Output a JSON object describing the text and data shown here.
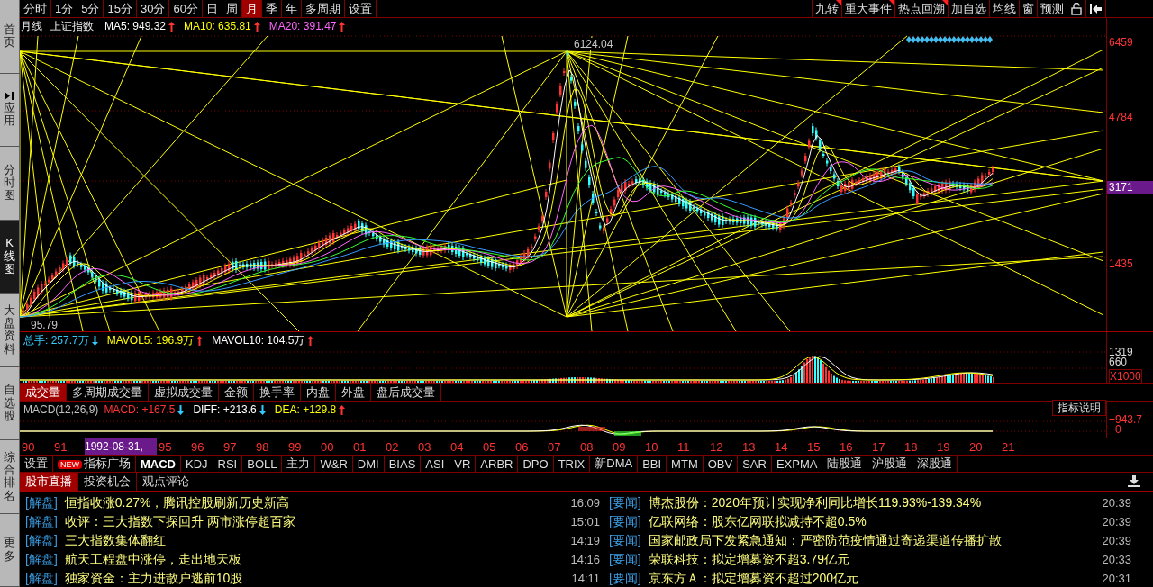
{
  "sidebar": {
    "items": [
      {
        "label": "首页",
        "selected": false,
        "kind": "text"
      },
      {
        "label": "应用",
        "selected": false,
        "kind": "play"
      },
      {
        "label": "分时图",
        "selected": false,
        "kind": "text"
      },
      {
        "label": "K线图",
        "selected": true,
        "kind": "text"
      },
      {
        "label": "大盘资料",
        "selected": false,
        "kind": "text"
      },
      {
        "label": "自选股",
        "selected": false,
        "kind": "text"
      },
      {
        "label": "综合排名",
        "selected": false,
        "kind": "text"
      },
      {
        "label": "更多",
        "selected": false,
        "kind": "text"
      }
    ]
  },
  "period_tabs": [
    {
      "label": "分时",
      "selected": false
    },
    {
      "label": "1分",
      "selected": false
    },
    {
      "label": "5分",
      "selected": false
    },
    {
      "label": "15分",
      "selected": false
    },
    {
      "label": "30分",
      "selected": false
    },
    {
      "label": "60分",
      "selected": false
    },
    {
      "label": "日",
      "selected": false
    },
    {
      "label": "周",
      "selected": false
    },
    {
      "label": "月",
      "selected": true
    },
    {
      "label": "季",
      "selected": false
    },
    {
      "label": "年",
      "selected": false
    },
    {
      "label": "多周期",
      "selected": false
    },
    {
      "label": "设置",
      "selected": false
    }
  ],
  "tool_buttons": [
    {
      "label": "九转",
      "flagged": true
    },
    {
      "label": "重大事件",
      "flagged": true
    },
    {
      "label": "热点回溯",
      "flagged": true
    },
    {
      "label": "加自选",
      "flagged": false
    },
    {
      "label": "均线",
      "flagged": false
    },
    {
      "label": "窗",
      "flagged": false
    },
    {
      "label": "预测",
      "flagged": false
    }
  ],
  "chart": {
    "period": "月线",
    "name": "上证指数",
    "indicators": [
      {
        "label": "MA5: 949.32",
        "color": "#ffffff",
        "rising": true
      },
      {
        "label": "MA10: 635.81",
        "color": "#ffff00",
        "rising": true
      },
      {
        "label": "MA20: 391.47",
        "color": "#ff66ff",
        "rising": true
      }
    ],
    "y_labels": [
      {
        "label": "6459",
        "selected": false
      },
      {
        "label": "4784",
        "selected": false
      },
      {
        "label": "3171",
        "selected": true
      },
      {
        "label": "1435",
        "selected": false
      }
    ],
    "high_label": "6124.04",
    "low_label": "95.79"
  },
  "volume": {
    "indicators": [
      {
        "label": "总手: 257.7万",
        "color": "#33ccff",
        "rising": false
      },
      {
        "label": "MAVOL5: 196.9万",
        "color": "#ffff00",
        "rising": true
      },
      {
        "label": "MAVOL10: 104.5万",
        "color": "#ffffff",
        "rising": true
      }
    ],
    "y_labels": [
      "1319",
      "660"
    ],
    "unit": "X1000"
  },
  "volume_tabs": [
    {
      "label": "成交量",
      "selected": true
    },
    {
      "label": "多周期成交量",
      "selected": false
    },
    {
      "label": "虚拟成交量",
      "selected": false
    },
    {
      "label": "金额",
      "selected": false
    },
    {
      "label": "换手率",
      "selected": false
    },
    {
      "label": "内盘",
      "selected": false
    },
    {
      "label": "外盘",
      "selected": false
    },
    {
      "label": "盘后成交量",
      "selected": false
    }
  ],
  "macd": {
    "indicators": [
      {
        "label": "MACD(12,26,9)",
        "color": "#c0c0c0"
      },
      {
        "label": "MACD: +167.5",
        "color": "#ff3333",
        "rising": false
      },
      {
        "label": "DIFF: +213.6",
        "color": "#ffffff",
        "rising": false
      },
      {
        "label": "DEA: +129.8",
        "color": "#ffff00",
        "rising": true
      }
    ],
    "help_button": "指标说明",
    "y_labels": [
      "+943.7",
      "+0"
    ]
  },
  "x_axis": [
    {
      "label": "90",
      "kind": "year"
    },
    {
      "label": "91",
      "kind": "year"
    },
    {
      "label": "1992-08-31,—",
      "kind": "cursor"
    },
    {
      "label": "95",
      "kind": "year"
    },
    {
      "label": "96",
      "kind": "year"
    },
    {
      "label": "97",
      "kind": "year"
    },
    {
      "label": "98",
      "kind": "year"
    },
    {
      "label": "99",
      "kind": "year"
    },
    {
      "label": "00",
      "kind": "year"
    },
    {
      "label": "01",
      "kind": "year"
    },
    {
      "label": "02",
      "kind": "year"
    },
    {
      "label": "03",
      "kind": "year"
    },
    {
      "label": "04",
      "kind": "year"
    },
    {
      "label": "05",
      "kind": "year"
    },
    {
      "label": "06",
      "kind": "year"
    },
    {
      "label": "07",
      "kind": "year"
    },
    {
      "label": "08",
      "kind": "year"
    },
    {
      "label": "09",
      "kind": "year"
    },
    {
      "label": "10",
      "kind": "year"
    },
    {
      "label": "11",
      "kind": "year"
    },
    {
      "label": "12",
      "kind": "year"
    },
    {
      "label": "13",
      "kind": "year"
    },
    {
      "label": "14",
      "kind": "year"
    },
    {
      "label": "15",
      "kind": "year"
    },
    {
      "label": "16",
      "kind": "year"
    },
    {
      "label": "17",
      "kind": "year"
    },
    {
      "label": "18",
      "kind": "year"
    },
    {
      "label": "19",
      "kind": "year"
    },
    {
      "label": "20",
      "kind": "year"
    },
    {
      "label": "21",
      "kind": "year"
    }
  ],
  "indicator_tabs": [
    {
      "label": "设置",
      "selected": false
    },
    {
      "label": "指标广场",
      "selected": false,
      "badge": "NEW"
    },
    {
      "label": "MACD",
      "selected": true
    },
    {
      "label": "KDJ",
      "selected": false
    },
    {
      "label": "RSI",
      "selected": false
    },
    {
      "label": "BOLL",
      "selected": false
    },
    {
      "label": "主力",
      "selected": false
    },
    {
      "label": "W&R",
      "selected": false
    },
    {
      "label": "DMI",
      "selected": false
    },
    {
      "label": "BIAS",
      "selected": false
    },
    {
      "label": "ASI",
      "selected": false
    },
    {
      "label": "VR",
      "selected": false
    },
    {
      "label": "ARBR",
      "selected": false
    },
    {
      "label": "DPO",
      "selected": false
    },
    {
      "label": "TRIX",
      "selected": false
    },
    {
      "label": "新DMA",
      "selected": false
    },
    {
      "label": "BBI",
      "selected": false
    },
    {
      "label": "MTM",
      "selected": false
    },
    {
      "label": "OBV",
      "selected": false
    },
    {
      "label": "SAR",
      "selected": false
    },
    {
      "label": "EXPMA",
      "selected": false
    },
    {
      "label": "陆股通",
      "selected": false
    },
    {
      "label": "沪股通",
      "selected": false
    },
    {
      "label": "深股通",
      "selected": false
    }
  ],
  "news_tabs": [
    {
      "label": "股市直播",
      "selected": true
    },
    {
      "label": "投资机会",
      "selected": false
    },
    {
      "label": "观点评论",
      "selected": false
    }
  ],
  "news": {
    "left": [
      {
        "tag": "[解盘]",
        "title": "恒指收涨0.27%，腾讯控股刷新历史新高",
        "time": "16:09"
      },
      {
        "tag": "[解盘]",
        "title": "收评：三大指数下探回升 两市涨停超百家",
        "time": "15:01"
      },
      {
        "tag": "[解盘]",
        "title": "三大指数集体翻红",
        "time": "14:19"
      },
      {
        "tag": "[解盘]",
        "title": "航天工程盘中涨停，走出地天板",
        "time": "14:16"
      },
      {
        "tag": "[解盘]",
        "title": "独家资金：主力进散户逃前10股",
        "time": "14:11"
      }
    ],
    "right": [
      {
        "tag": "[要闻]",
        "title": "博杰股份：2020年预计实现净利同比增长119.93%-139.34%",
        "time": "20:39"
      },
      {
        "tag": "[要闻]",
        "title": "亿联网络：股东亿网联拟减持不超0.5%",
        "time": "20:39"
      },
      {
        "tag": "[要闻]",
        "title": "国家邮政局下发紧急通知：严密防范疫情通过寄递渠道传播扩散",
        "time": "20:39"
      },
      {
        "tag": "[要闻]",
        "title": "荣联科技：拟定增募资不超3.79亿元",
        "time": "20:33"
      },
      {
        "tag": "[要闻]",
        "title": "京东方Ａ：拟定增募资不超过200亿元",
        "time": "20:31"
      }
    ]
  }
}
